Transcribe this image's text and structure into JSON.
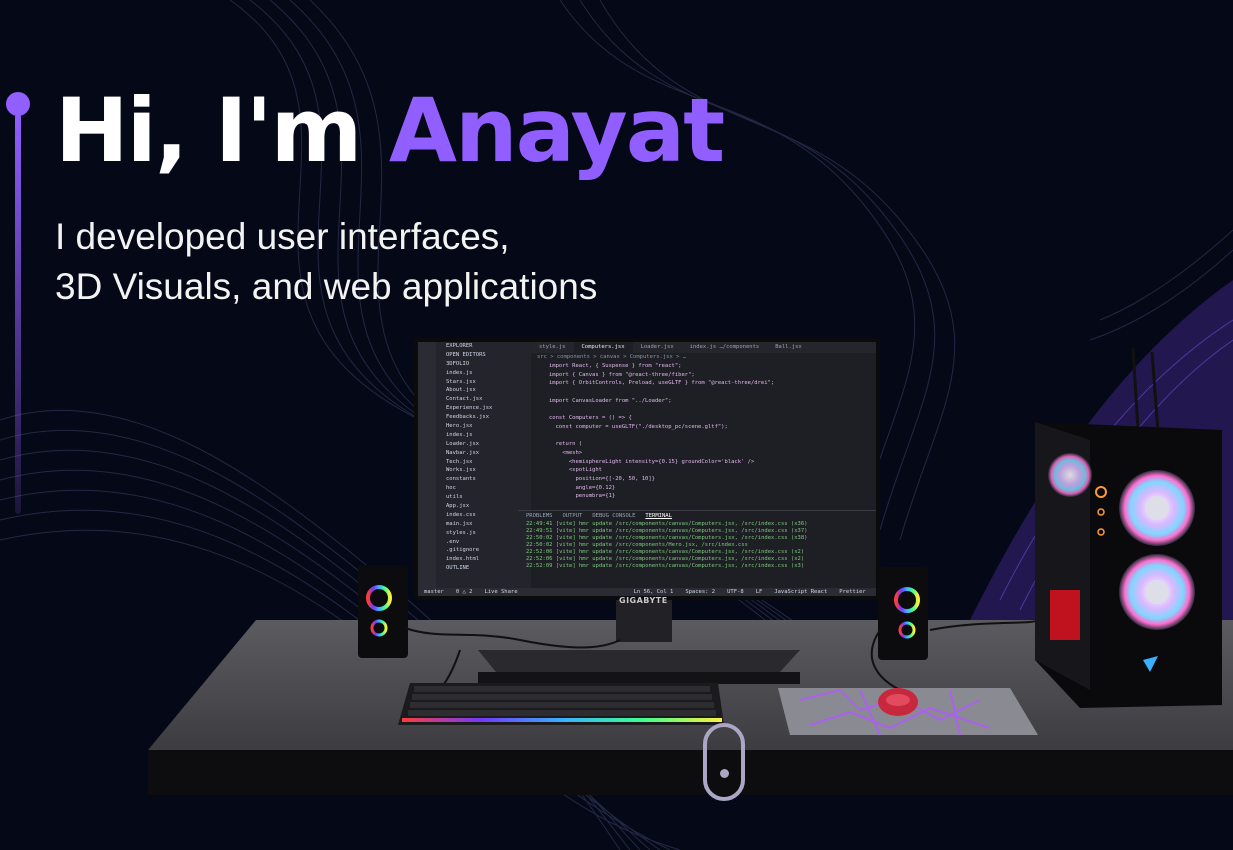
{
  "hero": {
    "greeting": "Hi, I'm ",
    "name": "Anayat",
    "subtitle_line1": "I developed user interfaces,",
    "subtitle_line2": "3D Visuals, and web applications"
  },
  "colors": {
    "background": "#050816",
    "accent": "#915EFF",
    "text": "#ffffff"
  },
  "monitor": {
    "brand": "GIGABYTE",
    "editor": {
      "tabs": [
        {
          "label": "style.js",
          "active": false
        },
        {
          "label": "Computers.jsx",
          "active": true
        },
        {
          "label": "Loader.jsx",
          "active": false
        },
        {
          "label": "index.js …/components",
          "active": false
        },
        {
          "label": "Ball.jsx",
          "active": false
        }
      ],
      "breadcrumb": "src > components > canvas > Computers.jsx > …",
      "explorer_items": [
        "EXPLORER",
        "OPEN EDITORS",
        "3DFOLIO",
        "index.js",
        "Stars.jsx",
        "About.jsx",
        "Contact.jsx",
        "Experience.jsx",
        "Feedbacks.jsx",
        "Hero.jsx",
        "index.js",
        "Loader.jsx",
        "Navbar.jsx",
        "Tech.jsx",
        "Works.jsx",
        "constants",
        "hoc",
        "utils",
        "App.jsx",
        "index.css",
        "main.jsx",
        "styles.js",
        ".env",
        ".gitignore",
        "index.html",
        "OUTLINE"
      ],
      "code_lines": [
        "import React, { Suspense } from \"react\";",
        "import { Canvas } from \"@react-three/fiber\";",
        "import { OrbitControls, Preload, useGLTF } from \"@react-three/drei\";",
        "",
        "import CanvasLoader from \"../Loader\";",
        "",
        "const Computers = () => {",
        "  const computer = useGLTF(\"./desktop_pc/scene.gltf\");",
        "",
        "  return (",
        "    <mesh>",
        "      <hemisphereLight intensity={0.15} groundColor='black' />",
        "      <spotLight",
        "        position={[-20, 50, 10]}",
        "        angle={0.12}",
        "        penumbra={1}"
      ],
      "panel_tabs": [
        "PROBLEMS",
        "OUTPUT",
        "DEBUG CONSOLE",
        "TERMINAL"
      ],
      "terminal_lines": [
        "22:49:41 [vite] hmr update /src/components/canvas/Computers.jsx, /src/index.css (x36)",
        "22:49:51 [vite] hmr update /src/components/canvas/Computers.jsx, /src/index.css (x37)",
        "22:50:02 [vite] hmr update /src/components/canvas/Computers.jsx, /src/index.css (x38)",
        "22:50:02 [vite] hmr update /src/components/Hero.jsx, /src/index.css",
        "22:52:06 [vite] hmr update /src/components/canvas/Computers.jsx, /src/index.css (x2)",
        "22:52:06 [vite] hmr update /src/components/canvas/Computers.jsx, /src/index.css (x2)",
        "22:52:09 [vite] hmr update /src/components/canvas/Computers.jsx, /src/index.css (x3)"
      ],
      "status_bar": [
        "master",
        "0 △ 2",
        "Live Share",
        "Ln 56, Col 1",
        "Spaces: 2",
        "UTF-8",
        "LF",
        "JavaScript React",
        "Prettier"
      ]
    }
  }
}
